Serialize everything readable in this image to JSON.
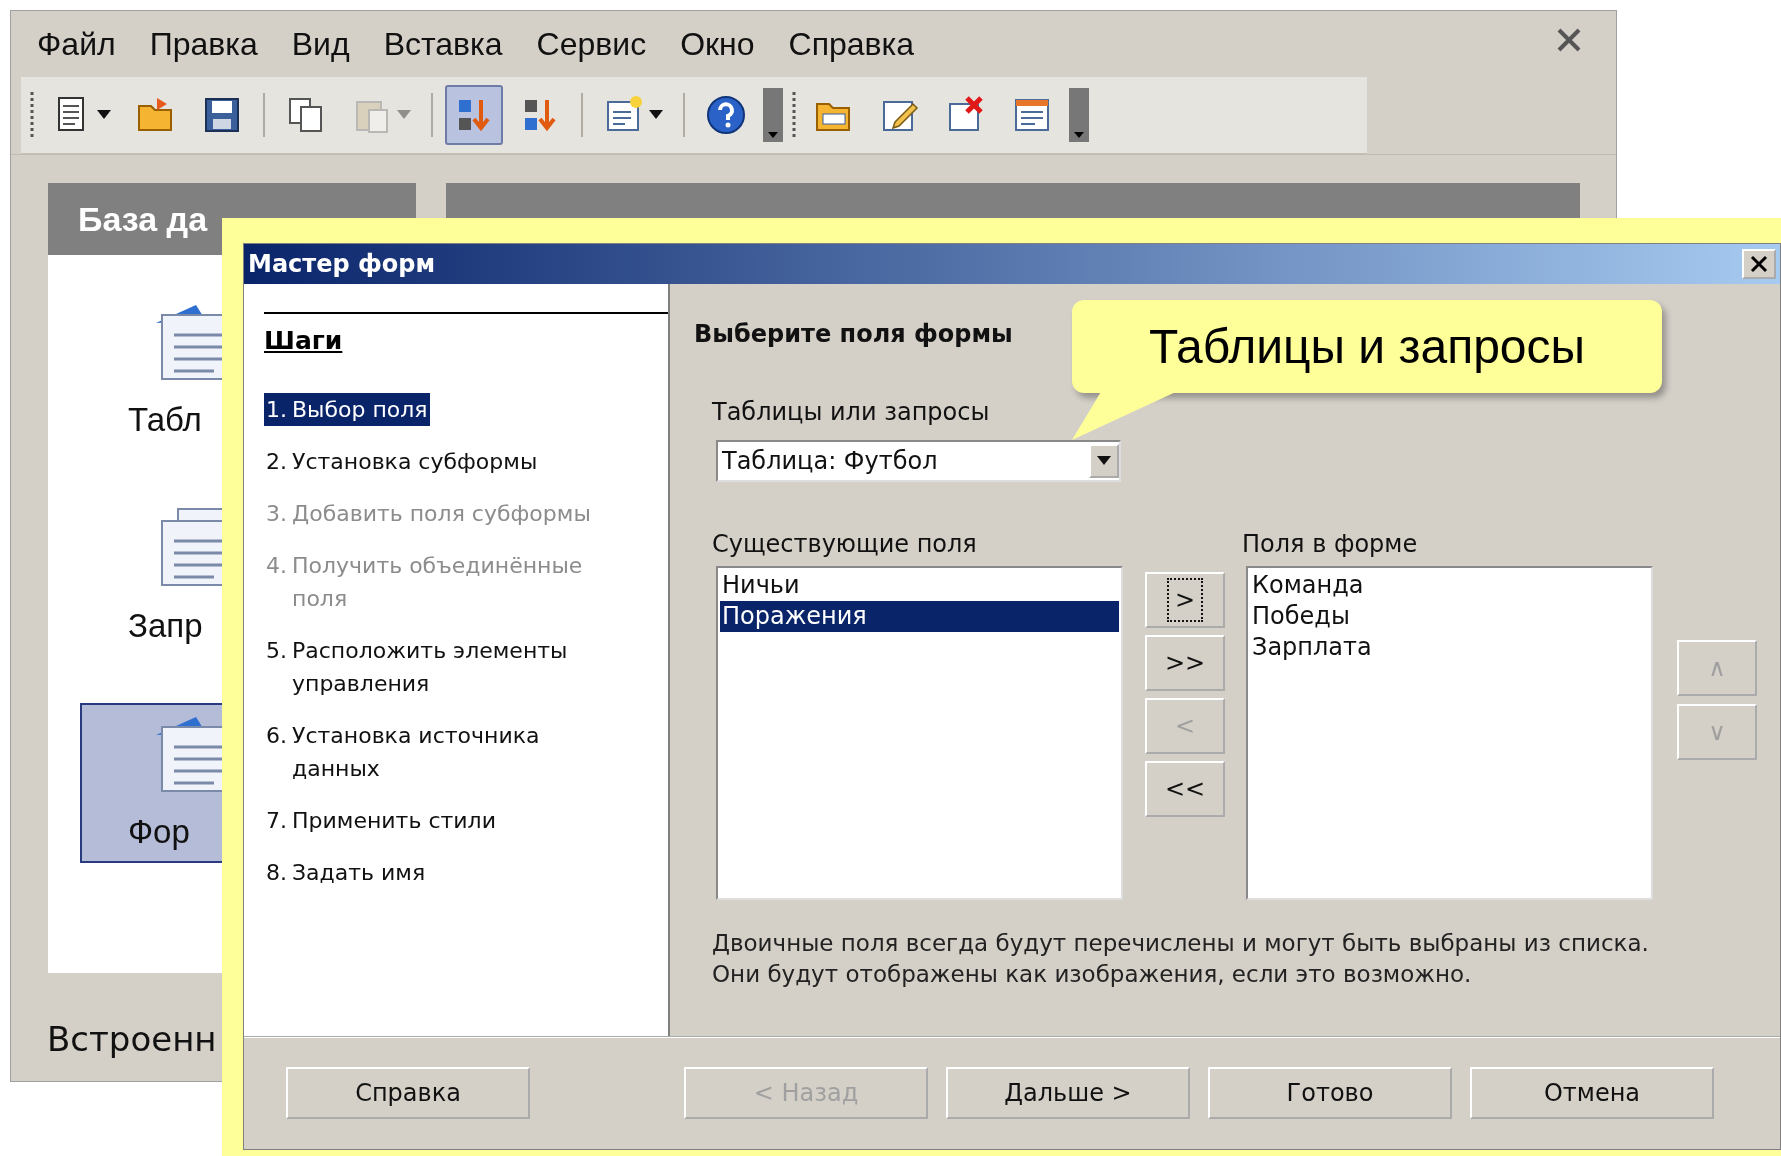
{
  "app": {
    "menu": [
      {
        "label": "Файл"
      },
      {
        "label": "Правка"
      },
      {
        "label": "Вид"
      },
      {
        "label": "Вставка"
      },
      {
        "label": "Сервис"
      },
      {
        "label": "Окно"
      },
      {
        "label": "Справка"
      }
    ],
    "toolbars": [
      {
        "groups": [
          [
            {
              "kind": "new",
              "dropdown": true,
              "pressed": false,
              "disabled": false
            },
            {
              "kind": "open",
              "dropdown": false,
              "pressed": false,
              "disabled": false
            },
            {
              "kind": "save",
              "dropdown": false,
              "pressed": false,
              "disabled": false
            }
          ],
          [
            {
              "kind": "copy",
              "dropdown": false,
              "pressed": false,
              "disabled": false
            },
            {
              "kind": "paste",
              "dropdown": true,
              "pressed": false,
              "disabled": true
            }
          ],
          [
            {
              "kind": "sort-asc",
              "dropdown": false,
              "pressed": true,
              "disabled": false
            },
            {
              "kind": "sort-desc",
              "dropdown": false,
              "pressed": false,
              "disabled": false
            }
          ],
          [
            {
              "kind": "form",
              "dropdown": true,
              "pressed": false,
              "disabled": false
            }
          ],
          [
            {
              "kind": "help",
              "dropdown": false,
              "pressed": false,
              "disabled": false
            }
          ]
        ]
      },
      {
        "groups": [
          [
            {
              "kind": "folder",
              "dropdown": false,
              "pressed": false,
              "disabled": false
            },
            {
              "kind": "edit",
              "dropdown": false,
              "pressed": false,
              "disabled": false
            },
            {
              "kind": "delete",
              "dropdown": false,
              "pressed": false,
              "disabled": false
            },
            {
              "kind": "properties",
              "dropdown": false,
              "pressed": false,
              "disabled": false
            }
          ]
        ]
      }
    ],
    "sidebar": {
      "title": "База да",
      "items": [
        {
          "kind": "tables",
          "label": "Табл",
          "selected": false
        },
        {
          "kind": "queries",
          "label": "Запр",
          "selected": false
        },
        {
          "kind": "forms",
          "label": "Фор",
          "selected": true
        }
      ]
    },
    "status": "Встроенн"
  },
  "dialog": {
    "title": "Мастер форм",
    "steps_title": "Шаги",
    "steps": [
      {
        "number": "1.",
        "label": "Выбор поля",
        "selected": true,
        "disabled": false
      },
      {
        "number": "2.",
        "label": "Установка субформы",
        "selected": false,
        "disabled": false
      },
      {
        "number": "3.",
        "label": "Добавить поля субформы",
        "selected": false,
        "disabled": true
      },
      {
        "number": "4.",
        "label": "Получить объединённые поля",
        "selected": false,
        "disabled": true
      },
      {
        "number": "5.",
        "label": "Расположить элементы управления",
        "selected": false,
        "disabled": false
      },
      {
        "number": "6.",
        "label": "Установка источника данных",
        "selected": false,
        "disabled": false
      },
      {
        "number": "7.",
        "label": "Применить стили",
        "selected": false,
        "disabled": false
      },
      {
        "number": "8.",
        "label": "Задать имя",
        "selected": false,
        "disabled": false
      }
    ],
    "heading": "Выберите поля формы",
    "source_label": "Таблицы или запросы",
    "source_value": "Таблица: Футбол",
    "available_label": "Существующие поля",
    "available": [
      {
        "label": "Ничьи",
        "selected": false
      },
      {
        "label": "Поражения",
        "selected": true
      }
    ],
    "form_label": "Поля в форме",
    "form_fields": [
      {
        "label": "Команда",
        "selected": false
      },
      {
        "label": "Победы",
        "selected": false
      },
      {
        "label": "Зарплата",
        "selected": false
      }
    ],
    "move_buttons": [
      {
        "label": ">",
        "disabled": false,
        "focused": true
      },
      {
        "label": ">>",
        "disabled": false,
        "focused": false
      },
      {
        "label": "<",
        "disabled": true,
        "focused": false
      },
      {
        "label": "<<",
        "disabled": false,
        "focused": false
      }
    ],
    "order_buttons": [
      {
        "label": "∧",
        "disabled": true
      },
      {
        "label": "∨",
        "disabled": true
      }
    ],
    "note": "Двоичные поля всегда будут перечислены и могут быть выбраны из списка.\nОни будут отображены как изображения, если это возможно.",
    "buttons": [
      {
        "label": "Справка",
        "disabled": false
      },
      {
        "label": "< Назад",
        "disabled": true
      },
      {
        "label": "Дальше >",
        "disabled": false
      },
      {
        "label": "Готово",
        "disabled": false
      },
      {
        "label": "Отмена",
        "disabled": false
      }
    ]
  },
  "callout": {
    "text": "Таблицы и запросы"
  }
}
